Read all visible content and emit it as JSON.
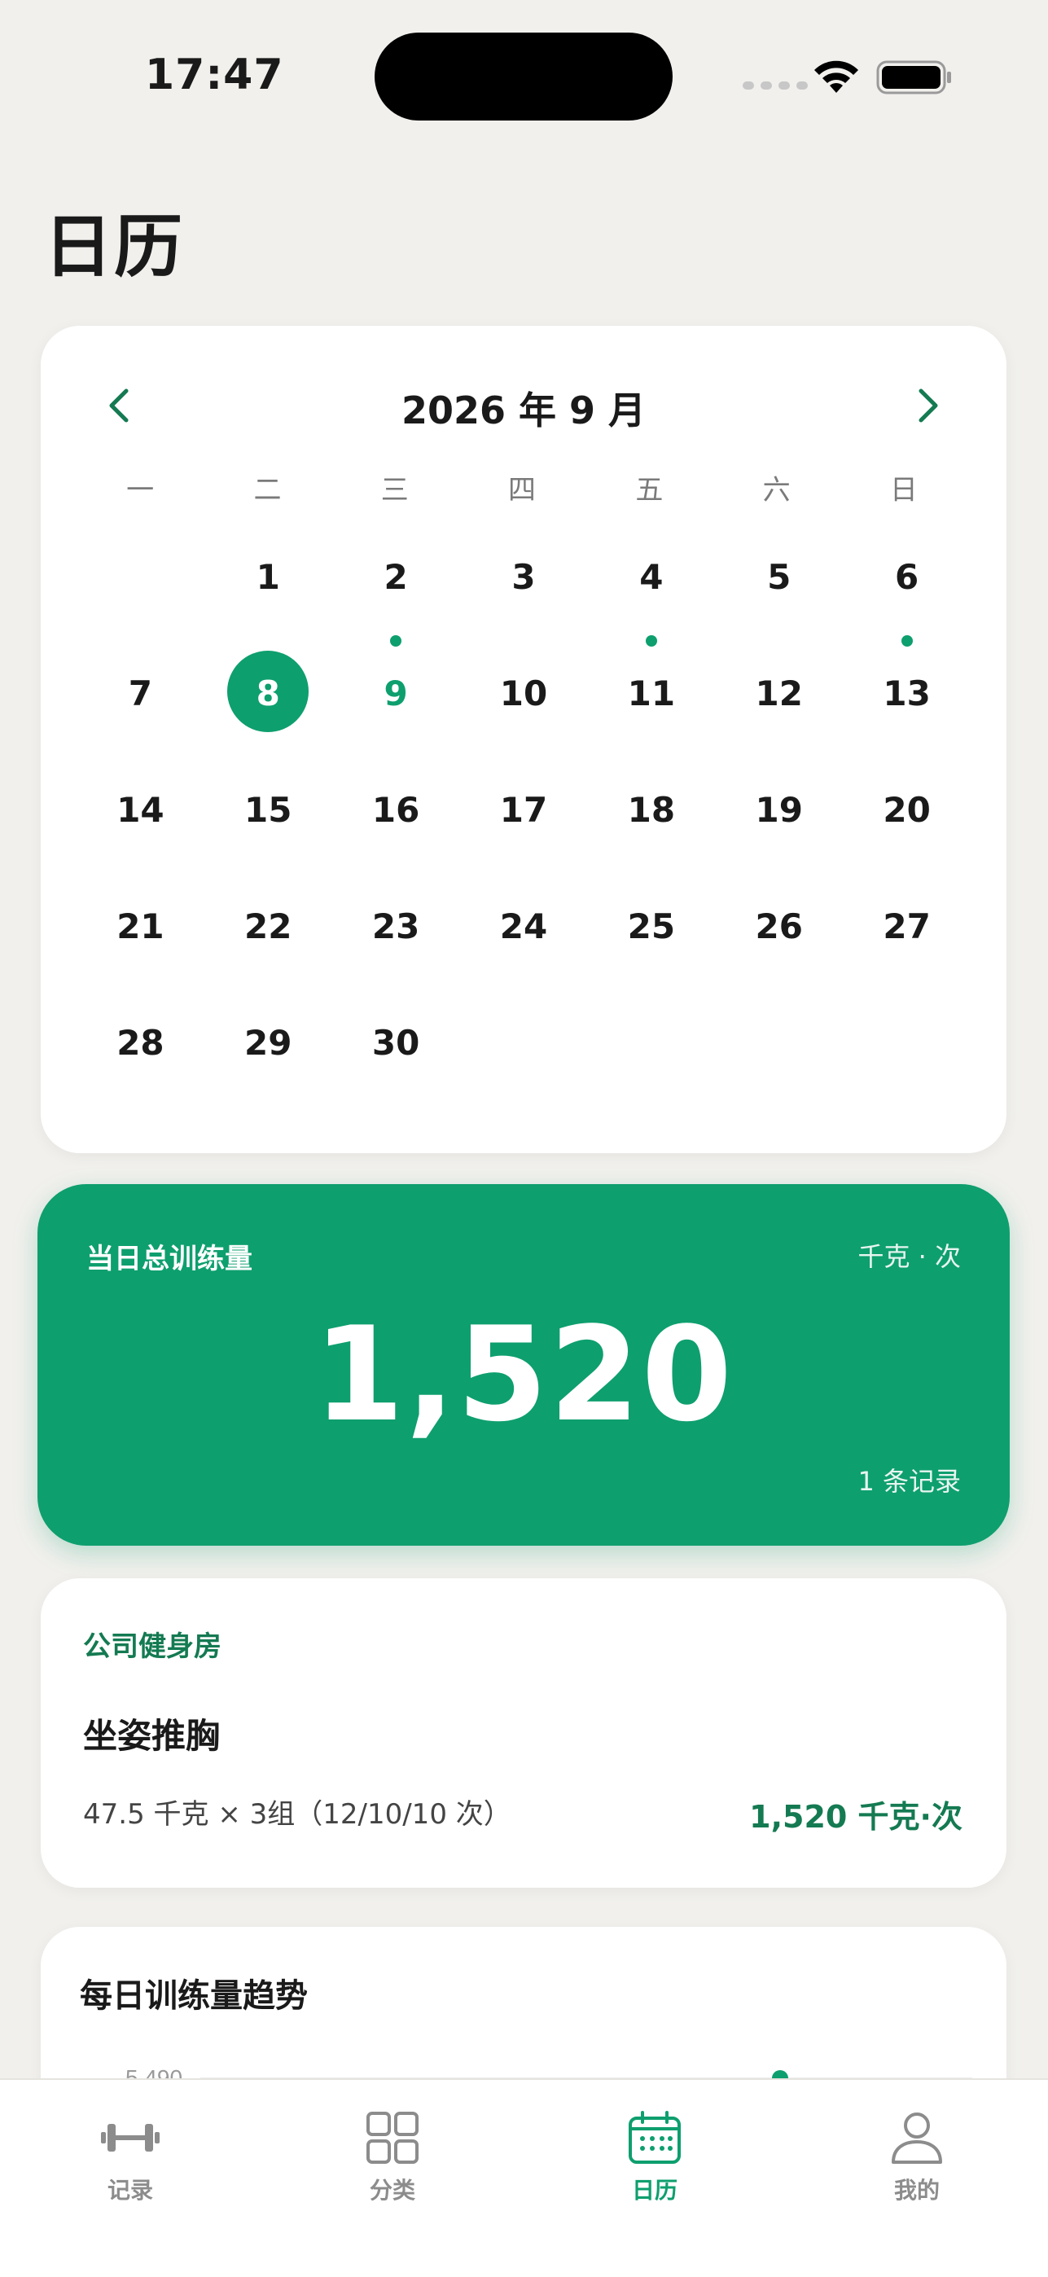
{
  "status_bar": {
    "time": "17:47"
  },
  "page": {
    "title": "日历"
  },
  "calendar": {
    "month_label": "2026 年 9 月",
    "weekdays": [
      "一",
      "二",
      "三",
      "四",
      "五",
      "六",
      "日"
    ],
    "days": [
      {
        "n": "",
        "dot": false
      },
      {
        "n": "1",
        "dot": false
      },
      {
        "n": "2",
        "dot": true
      },
      {
        "n": "3",
        "dot": false
      },
      {
        "n": "4",
        "dot": true
      },
      {
        "n": "5",
        "dot": false
      },
      {
        "n": "6",
        "dot": true
      },
      {
        "n": "7",
        "dot": false
      },
      {
        "n": "8",
        "dot": false,
        "selected": true
      },
      {
        "n": "9",
        "dot": false,
        "today": true
      },
      {
        "n": "10",
        "dot": false
      },
      {
        "n": "11",
        "dot": false
      },
      {
        "n": "12",
        "dot": false
      },
      {
        "n": "13",
        "dot": false
      },
      {
        "n": "14",
        "dot": false
      },
      {
        "n": "15",
        "dot": false
      },
      {
        "n": "16",
        "dot": false
      },
      {
        "n": "17",
        "dot": false
      },
      {
        "n": "18",
        "dot": false
      },
      {
        "n": "19",
        "dot": false
      },
      {
        "n": "20",
        "dot": false
      },
      {
        "n": "21",
        "dot": false
      },
      {
        "n": "22",
        "dot": false
      },
      {
        "n": "23",
        "dot": false
      },
      {
        "n": "24",
        "dot": false
      },
      {
        "n": "25",
        "dot": false
      },
      {
        "n": "26",
        "dot": false
      },
      {
        "n": "27",
        "dot": false
      },
      {
        "n": "28",
        "dot": false
      },
      {
        "n": "29",
        "dot": false
      },
      {
        "n": "30",
        "dot": false
      }
    ],
    "accent_color": "#0e9f6e"
  },
  "total": {
    "label": "当日总训练量",
    "unit": "千克 · 次",
    "value": "1,520",
    "count": "1 条记录"
  },
  "record": {
    "gym": "公司健身房",
    "exercise": "坐姿推胸",
    "detail": "47.5 千克 × 3组（12/10/10 次）",
    "volume": "1,520 千克·次"
  },
  "trend": {
    "title": "每日训练量趋势",
    "tick_label": "5,490"
  },
  "tabs": [
    {
      "label": "记录",
      "icon": "dumbbell-icon",
      "active": false
    },
    {
      "label": "分类",
      "icon": "grid-icon",
      "active": false
    },
    {
      "label": "日历",
      "icon": "calendar-icon",
      "active": true
    },
    {
      "label": "我的",
      "icon": "person-icon",
      "active": false
    }
  ],
  "chart_data": {
    "type": "line",
    "title": "每日训练量趋势",
    "y_ticks": [
      "5,490"
    ],
    "series": [
      {
        "values": [
          5490
        ]
      }
    ]
  }
}
